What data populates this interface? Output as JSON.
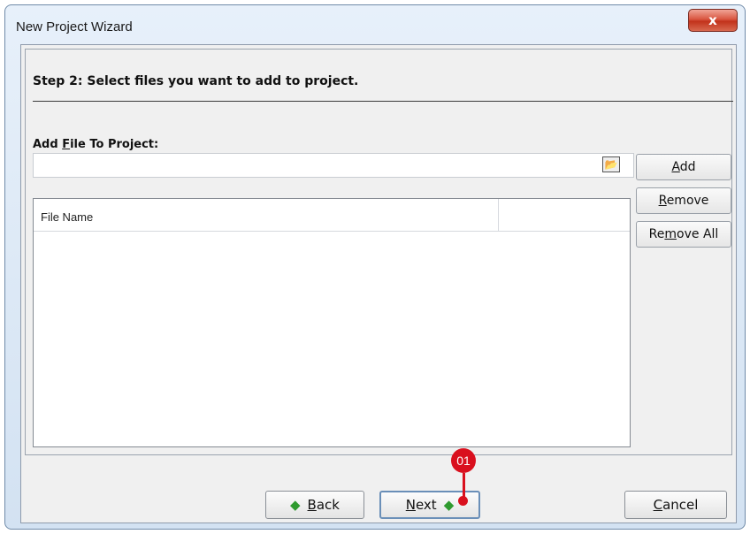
{
  "window": {
    "title": "New Project Wizard",
    "close_glyph": "x"
  },
  "step": {
    "heading": "Step 2: Select files you want to add to project."
  },
  "file_field": {
    "label": "Add File To Project:",
    "value": "",
    "browse_icon": "folder-open-icon"
  },
  "side_buttons": {
    "add_label": "Add",
    "remove_label": "Remove",
    "remove_all_label": "Remove All"
  },
  "file_list": {
    "columns": [
      "File Name",
      ""
    ],
    "rows": []
  },
  "footer": {
    "back_label": "Back",
    "next_label": "Next",
    "cancel_label": "Cancel"
  },
  "callout": {
    "number": "01",
    "color": "#d9101e"
  }
}
